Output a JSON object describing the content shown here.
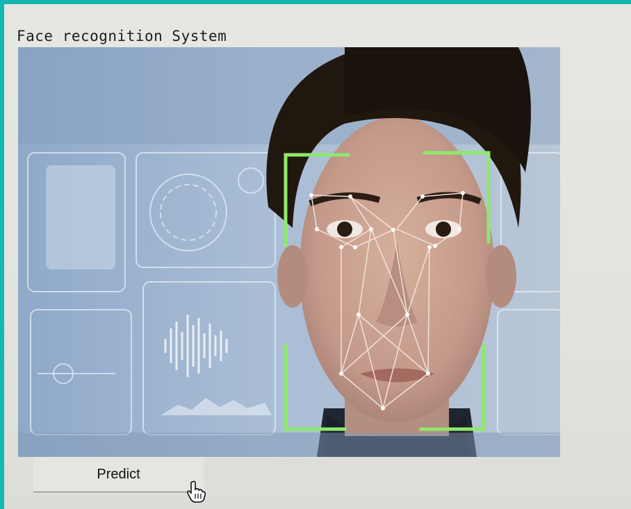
{
  "app": {
    "title": "Face recognition System"
  },
  "image": {
    "icon": "face-landmark-photo"
  },
  "predict": {
    "label": "Predict"
  },
  "cursor": {
    "icon": "hand-pointer-icon"
  },
  "colors": {
    "frame": "#15b8b0",
    "window_bg": "#e4e5e0",
    "bracket": "#8ee86c",
    "landmark_line": "#f1e4d9"
  }
}
